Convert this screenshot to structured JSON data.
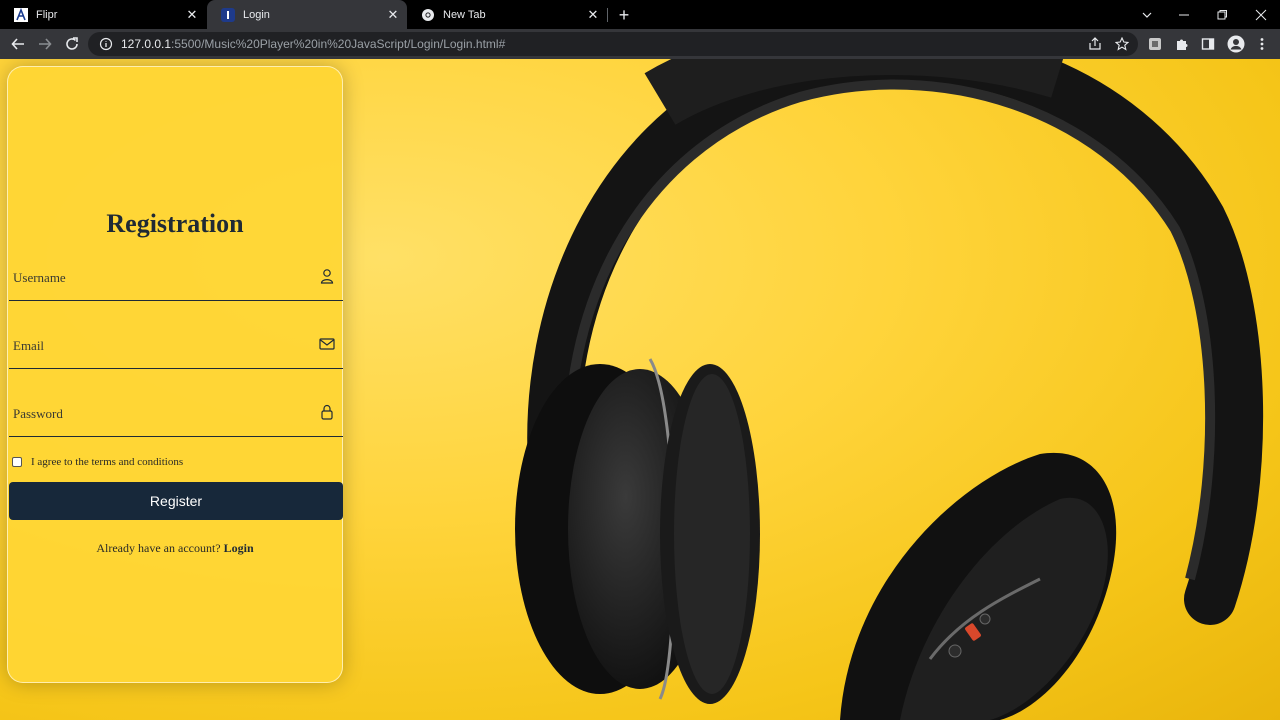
{
  "browser": {
    "tabs": [
      {
        "title": "Flipr",
        "favicon": "flipr-favicon"
      },
      {
        "title": "Login",
        "favicon": "login-favicon",
        "active": true
      },
      {
        "title": "New Tab",
        "favicon": "chrome-favicon"
      }
    ],
    "url_host": "127.0.0.1",
    "url_rest": ":5500/Music%20Player%20in%20JavaScript/Login/Login.html#"
  },
  "form": {
    "title": "Registration",
    "username_label": "Username",
    "email_label": "Email",
    "password_label": "Password",
    "agree_text": "I agree to the terms and conditions",
    "agree_checked": false,
    "register_label": "Register",
    "already_text": "Already have an account?",
    "login_link": "Login"
  },
  "colors": {
    "background_yellow": "#ffd43b",
    "button_dark": "#17283a",
    "browser_dark": "#35363a"
  }
}
